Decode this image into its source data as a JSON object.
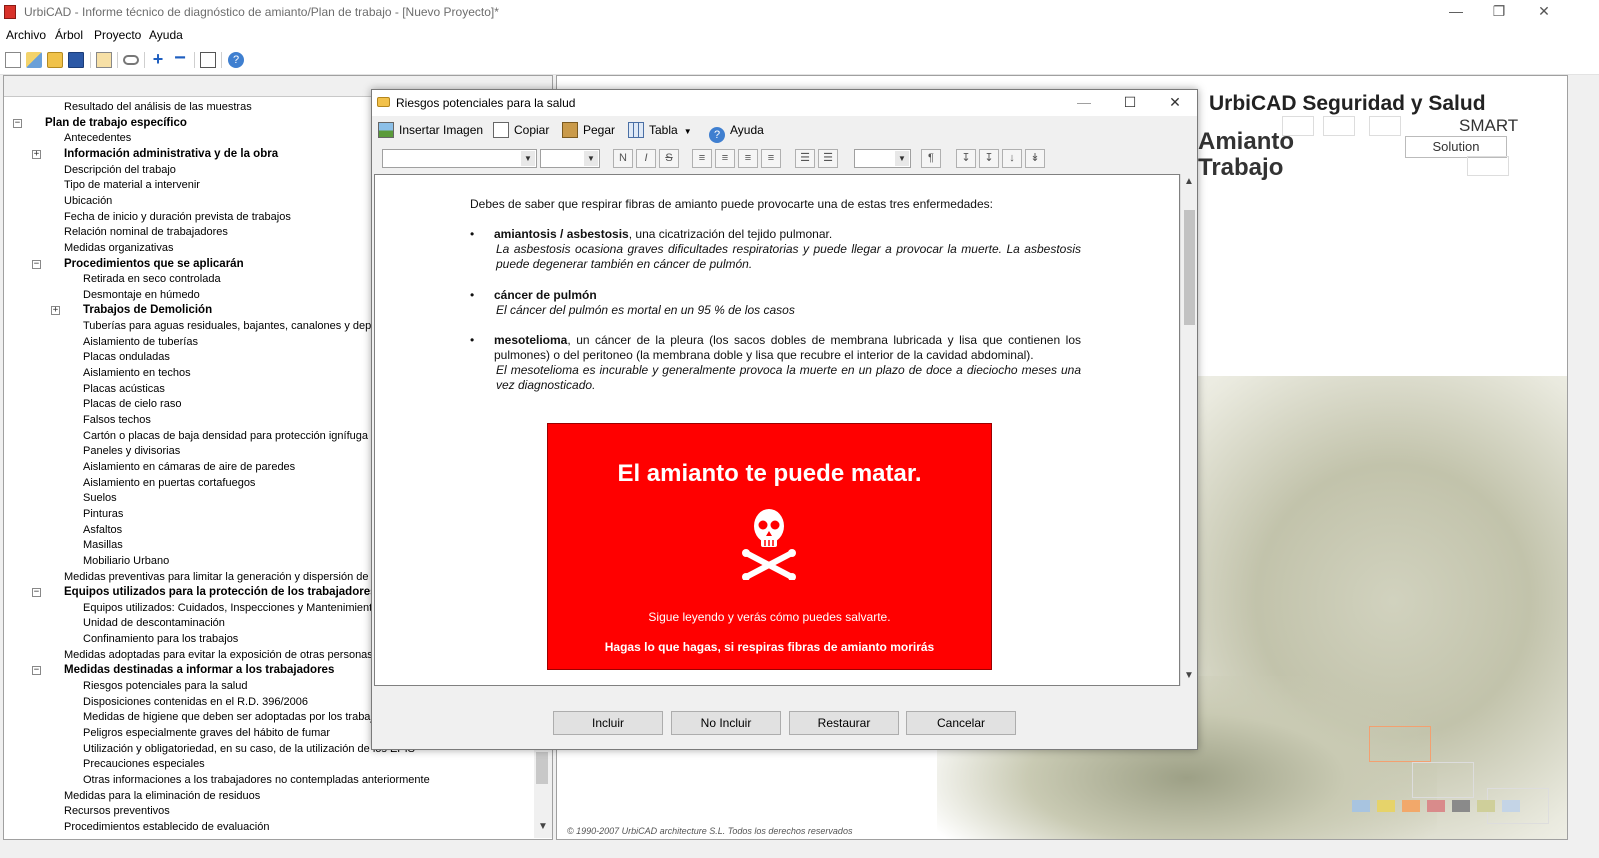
{
  "window": {
    "title": "UrbiCAD - Informe técnico de diagnóstico de amianto/Plan de trabajo  - [Nuevo Proyecto]*",
    "minimize": "—",
    "maximize": "❐",
    "close": "✕"
  },
  "menu": [
    "Archivo",
    "Árbol",
    "Proyecto",
    "Ayuda"
  ],
  "toolbar_icons": [
    "new-file-icon",
    "open-wizard-icon",
    "open-folder-icon",
    "save-icon",
    "copy-icon",
    "link-icon",
    "add-icon",
    "remove-icon",
    "edit-icon",
    "help-icon"
  ],
  "tree": [
    {
      "label": "Resultado del análisis de las muestras",
      "level": 2,
      "bold": false,
      "expander": ""
    },
    {
      "label": "Plan de trabajo específico",
      "level": 1,
      "bold": true,
      "expander": "−"
    },
    {
      "label": "Antecedentes",
      "level": 2,
      "bold": false,
      "expander": ""
    },
    {
      "label": "Información administrativa y de la obra",
      "level": 2,
      "bold": true,
      "expander": "+"
    },
    {
      "label": "Descripción del trabajo",
      "level": 2,
      "bold": false,
      "expander": ""
    },
    {
      "label": "Tipo de material a intervenir",
      "level": 2,
      "bold": false,
      "expander": ""
    },
    {
      "label": "Ubicación",
      "level": 2,
      "bold": false,
      "expander": ""
    },
    {
      "label": "Fecha de inicio y duración prevista de trabajos",
      "level": 2,
      "bold": false,
      "expander": ""
    },
    {
      "label": "Relación nominal de trabajadores",
      "level": 2,
      "bold": false,
      "expander": ""
    },
    {
      "label": "Medidas organizativas",
      "level": 2,
      "bold": false,
      "expander": ""
    },
    {
      "label": "Procedimientos que se aplicarán",
      "level": 2,
      "bold": true,
      "expander": "−"
    },
    {
      "label": "Retirada en seco controlada",
      "level": 3,
      "bold": false,
      "expander": ""
    },
    {
      "label": "Desmontaje en húmedo",
      "level": 3,
      "bold": false,
      "expander": ""
    },
    {
      "label": "Trabajos de Demolición",
      "level": 3,
      "bold": true,
      "expander": "+"
    },
    {
      "label": "Tuberías para aguas residuales, bajantes, canalones y depósitos",
      "level": 3,
      "bold": false,
      "expander": ""
    },
    {
      "label": "Aislamiento de tuberías",
      "level": 3,
      "bold": false,
      "expander": ""
    },
    {
      "label": "Placas onduladas",
      "level": 3,
      "bold": false,
      "expander": ""
    },
    {
      "label": "Aislamiento en techos",
      "level": 3,
      "bold": false,
      "expander": ""
    },
    {
      "label": "Placas acústicas",
      "level": 3,
      "bold": false,
      "expander": ""
    },
    {
      "label": "Placas de cielo raso",
      "level": 3,
      "bold": false,
      "expander": ""
    },
    {
      "label": "Falsos techos",
      "level": 3,
      "bold": false,
      "expander": ""
    },
    {
      "label": "Cartón o placas de baja densidad para protección ignífuga",
      "level": 3,
      "bold": false,
      "expander": ""
    },
    {
      "label": "Paneles y divisorias",
      "level": 3,
      "bold": false,
      "expander": ""
    },
    {
      "label": "Aislamiento en cámaras de aire de paredes",
      "level": 3,
      "bold": false,
      "expander": ""
    },
    {
      "label": "Aislamiento en puertas cortafuegos",
      "level": 3,
      "bold": false,
      "expander": ""
    },
    {
      "label": "Suelos",
      "level": 3,
      "bold": false,
      "expander": ""
    },
    {
      "label": "Pinturas",
      "level": 3,
      "bold": false,
      "expander": ""
    },
    {
      "label": "Asfaltos",
      "level": 3,
      "bold": false,
      "expander": ""
    },
    {
      "label": "Masillas",
      "level": 3,
      "bold": false,
      "expander": ""
    },
    {
      "label": "Mobiliario Urbano",
      "level": 3,
      "bold": false,
      "expander": ""
    },
    {
      "label": "Medidas preventivas para limitar la generación y dispersión de fibras",
      "level": 2,
      "bold": false,
      "expander": ""
    },
    {
      "label": "Equipos utilizados para la protección de los trabajadores",
      "level": 2,
      "bold": true,
      "expander": "−"
    },
    {
      "label": "Equipos utilizados: Cuidados, Inspecciones y Mantenimientos",
      "level": 3,
      "bold": false,
      "expander": ""
    },
    {
      "label": "Unidad de descontaminación",
      "level": 3,
      "bold": false,
      "expander": ""
    },
    {
      "label": "Confinamiento para los trabajos",
      "level": 3,
      "bold": false,
      "expander": ""
    },
    {
      "label": "Medidas adoptadas para evitar la exposición de otras personas",
      "level": 2,
      "bold": false,
      "expander": ""
    },
    {
      "label": "Medidas destinadas a informar a los trabajadores",
      "level": 2,
      "bold": true,
      "expander": "−"
    },
    {
      "label": "Riesgos potenciales para la salud",
      "level": 3,
      "bold": false,
      "expander": ""
    },
    {
      "label": "Disposiciones contenidas en el R.D. 396/2006",
      "level": 3,
      "bold": false,
      "expander": ""
    },
    {
      "label": "Medidas de higiene que deben ser adoptadas por los trabajadores",
      "level": 3,
      "bold": false,
      "expander": ""
    },
    {
      "label": "Peligros especialmente graves del hábito de fumar",
      "level": 3,
      "bold": false,
      "expander": ""
    },
    {
      "label": "Utilización y obligatoriedad, en su caso, de la utilización de los EPIS",
      "level": 3,
      "bold": false,
      "expander": ""
    },
    {
      "label": "Precauciones especiales",
      "level": 3,
      "bold": false,
      "expander": ""
    },
    {
      "label": "Otras informaciones a los trabajadores no contempladas anteriormente",
      "level": 3,
      "bold": false,
      "expander": ""
    },
    {
      "label": "Medidas para la eliminación de residuos",
      "level": 2,
      "bold": false,
      "expander": ""
    },
    {
      "label": "Recursos preventivos",
      "level": 2,
      "bold": false,
      "expander": ""
    },
    {
      "label": "Procedimientos establecido de evaluación",
      "level": 2,
      "bold": false,
      "expander": ""
    }
  ],
  "background": {
    "brand_line1": "UrbiCAD Seguridad y Salud",
    "brand_line2": "Amianto",
    "brand_line3": "Trabajo",
    "smart": "SMART",
    "solution": "Solution",
    "copyright": "© 1990-2007 UrbiCAD architecture S.L. Todos los derechos reservados"
  },
  "dialog": {
    "title": "Riesgos potenciales para la salud",
    "minimize": "—",
    "maximize": "☐",
    "close": "✕",
    "toolbar": {
      "insert_image": "Insertar Imagen",
      "copy": "Copiar",
      "paste": "Pegar",
      "table": "Tabla",
      "help": "Ayuda"
    },
    "format": {
      "bold": "N",
      "italic": "I",
      "strike": "S",
      "paragraph": "¶"
    },
    "document": {
      "intro": "Debes de saber que respirar fibras de amianto puede provocarte una de estas tres enfermedades:",
      "bullets": [
        {
          "term": "amiantosis / asbestosis",
          "rest": ", una cicatrización del tejido pulmonar.",
          "italic": "La asbestosis ocasiona graves dificultades respiratorias y puede llegar a provocar la muerte. La asbestosis puede degenerar también en cáncer de pulmón."
        },
        {
          "term": "cáncer de pulmón",
          "rest": "",
          "italic": "El cáncer del pulmón es mortal en un 95 % de los casos"
        },
        {
          "term": "mesotelioma",
          "rest": ", un cáncer de la pleura (los sacos dobles de membrana lubricada y lisa que contienen los pulmones) o del peritoneo (la membrana doble y lisa que recubre el interior de la cavidad abdominal).",
          "italic": "El mesotelioma es incurable y generalmente provoca la muerte en un plazo de doce a dieciocho meses una vez diagnosticado."
        }
      ],
      "bullet_char": "•",
      "warning": {
        "title": "El amianto te puede matar.",
        "subtitle": "Sigue leyendo y verás cómo puedes salvarte.",
        "strong": "Hagas lo que hagas, si respiras fibras de amianto morirás",
        "color": "#ff0000"
      }
    },
    "buttons": {
      "include": "Incluir",
      "exclude": "No Incluir",
      "restore": "Restaurar",
      "cancel": "Cancelar"
    }
  }
}
